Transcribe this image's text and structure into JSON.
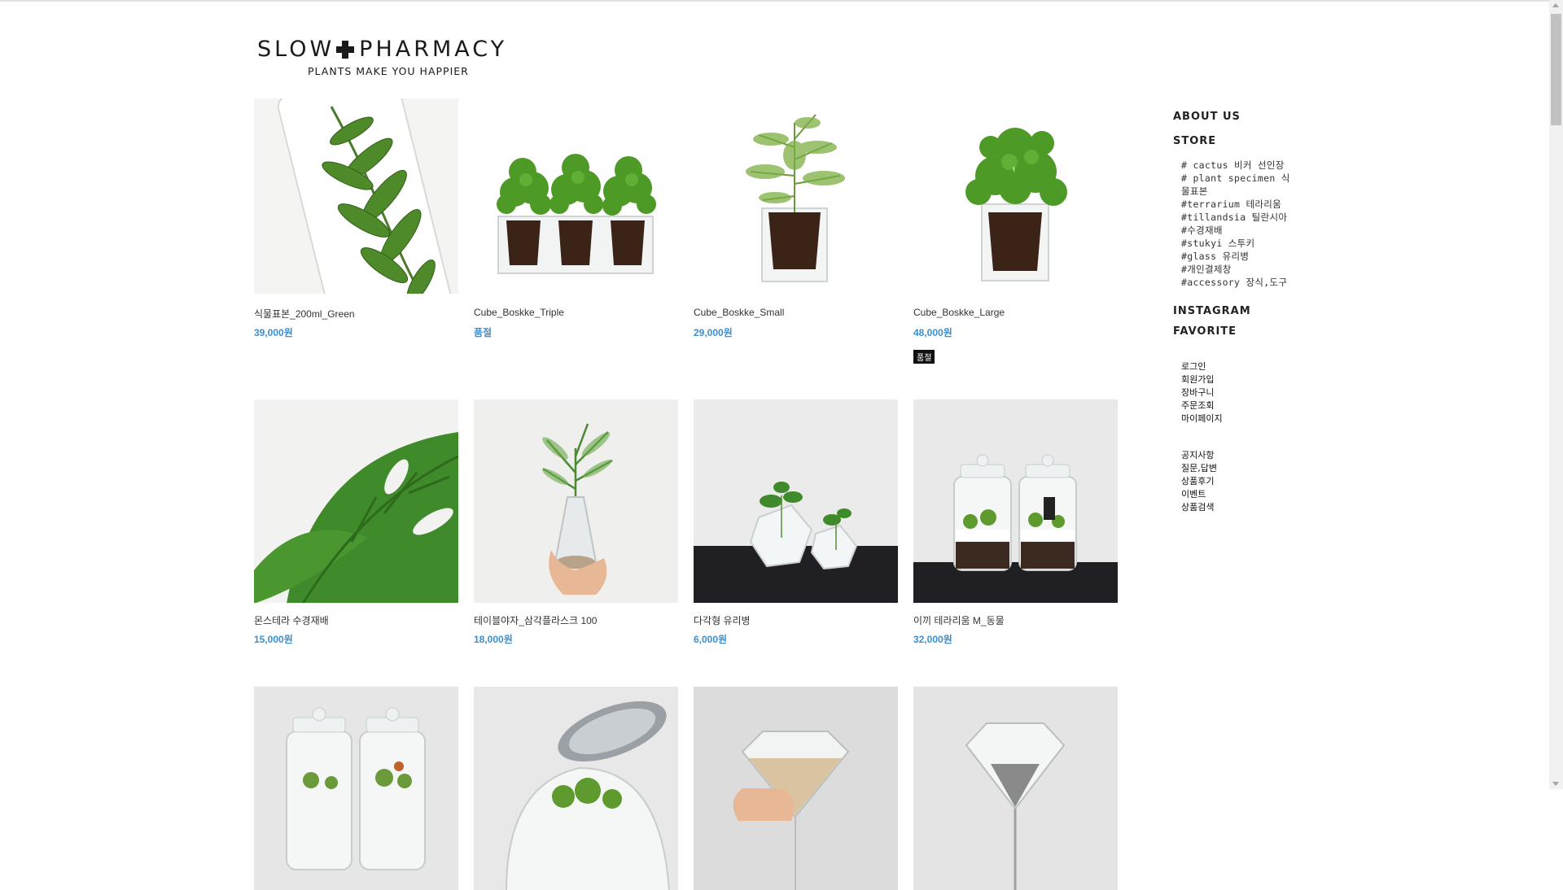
{
  "brand": {
    "title_left": "SLOW",
    "title_right": "PHARMACY",
    "tagline": "PLANTS MAKE YOU HAPPIER"
  },
  "products": [
    {
      "name": "식물표본_200ml_Green",
      "price": "39,000원",
      "image": "leaf-specimen-bottle"
    },
    {
      "name": "Cube_Boskke_Triple",
      "price": "품절",
      "image": "basil-triple-pots"
    },
    {
      "name": "Cube_Boskke_Small",
      "price": "29,000원",
      "image": "asparagus-fern-pot"
    },
    {
      "name": "Cube_Boskke_Large",
      "price": "48,000원",
      "badge": "품절",
      "image": "basil-large-pot"
    },
    {
      "name": "몬스테라 수경재배",
      "price": "15,000원",
      "image": "monstera-leaf"
    },
    {
      "name": "테이블야자_삼각플라스크 100",
      "price": "18,000원",
      "image": "palm-flask-in-hand"
    },
    {
      "name": "다각형 유리병",
      "price": "6,000원",
      "image": "polygon-glass-vases"
    },
    {
      "name": "이끼 테라리움 M_동물",
      "price": "32,000원",
      "image": "moss-terrarium-jars"
    },
    {
      "name": "",
      "price": "",
      "image": "terrarium-jars-partial"
    },
    {
      "name": "",
      "price": "",
      "image": "moss-jar-partial"
    },
    {
      "name": "",
      "price": "",
      "image": "diamond-sand-timer-hand"
    },
    {
      "name": "",
      "price": "",
      "image": "diamond-sand-timer"
    }
  ],
  "sidebar": {
    "about": "ABOUT US",
    "store": "STORE",
    "categories": [
      "# cactus 비커 선인장",
      "# plant specimen 식",
      "물표본",
      "#terrarium 테라리움",
      "#tillandsia 틸란시아",
      "#수경재배",
      "#stukyi 스투키",
      "#glass 유리병",
      "#개인결제창",
      "#accessory 장식,도구"
    ],
    "instagram": "INSTAGRAM",
    "favorite": "FAVORITE",
    "account_links": [
      "로그인",
      "회원가입",
      "장바구니",
      "주문조회",
      "마이페이지"
    ],
    "board_links": [
      "공지사항",
      "질문,답변",
      "상품후기",
      "이벤트",
      "상품검색"
    ]
  },
  "colors": {
    "price": "#3a8fd0",
    "badge_bg": "#111111",
    "text": "#333333"
  }
}
